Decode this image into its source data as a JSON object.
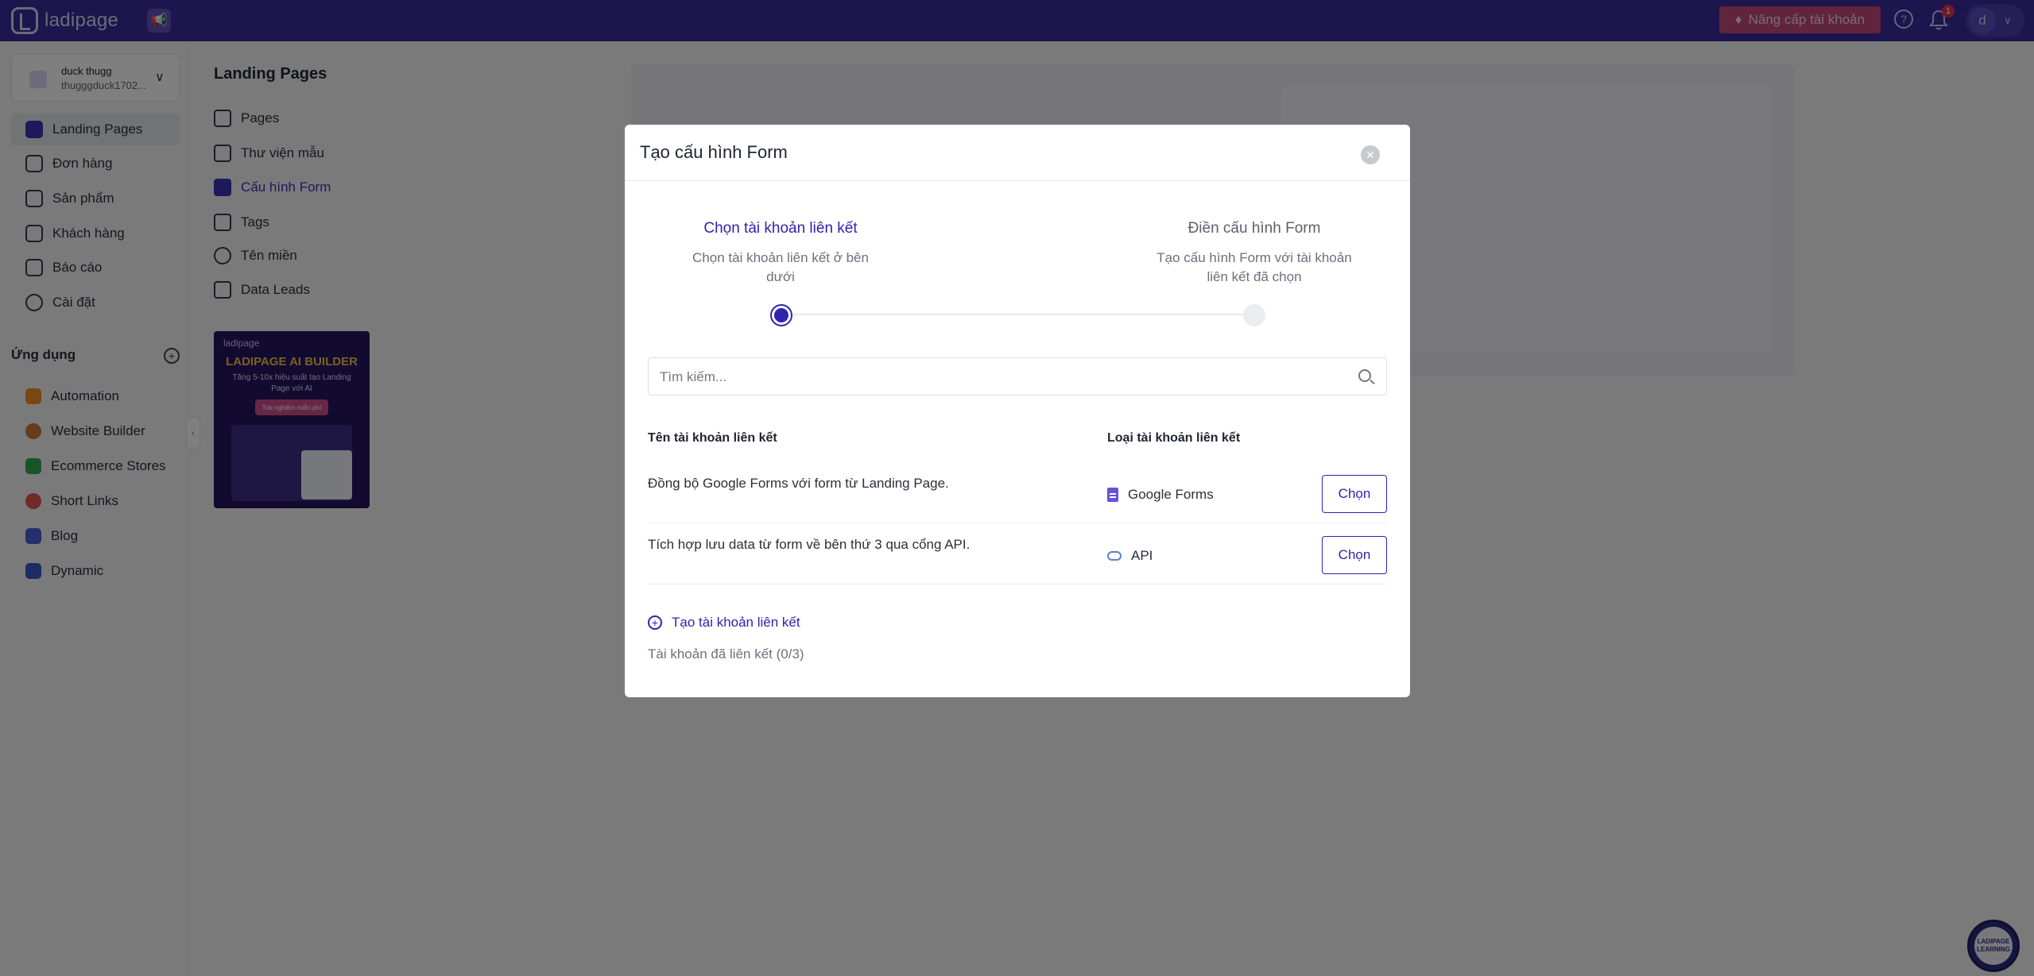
{
  "topbar": {
    "brand": "ladipage",
    "upgrade_label": "Nâng cấp tài khoản",
    "notification_count": "1",
    "avatar_initial": "d"
  },
  "account": {
    "name": "duck thugg",
    "email": "thugggduck1702..."
  },
  "leftnav": {
    "items": [
      {
        "label": "Landing Pages"
      },
      {
        "label": "Đơn hàng"
      },
      {
        "label": "Sản phẩm"
      },
      {
        "label": "Khách hàng"
      },
      {
        "label": "Báo cáo"
      },
      {
        "label": "Cài đặt"
      }
    ],
    "apps_title": "Ứng dụng",
    "apps": [
      {
        "label": "Automation",
        "color": "#f28c28"
      },
      {
        "label": "Website Builder",
        "color": "#c9783e"
      },
      {
        "label": "Ecommerce Stores",
        "color": "#2fa84f"
      },
      {
        "label": "Short Links",
        "color": "#e2554f"
      },
      {
        "label": "Blog",
        "color": "#4a5fd6"
      },
      {
        "label": "Dynamic",
        "color": "#3b5bc7"
      }
    ]
  },
  "subnav": {
    "title": "Landing Pages",
    "items": [
      {
        "label": "Pages"
      },
      {
        "label": "Thư viện mẫu"
      },
      {
        "label": "Cấu hình Form"
      },
      {
        "label": "Tags"
      },
      {
        "label": "Tên miền"
      },
      {
        "label": "Data Leads"
      }
    ],
    "banner": {
      "logo": "ladipage",
      "title": "LADIPAGE AI BUILDER",
      "subtitle": "Tăng 5-10x hiệu suất tạo Landing Page với AI",
      "button": "Trải nghiệm miễn phí"
    }
  },
  "modal": {
    "title": "Tạo cấu hình Form",
    "steps": [
      {
        "title": "Chọn tài khoản liên kết",
        "desc": "Chọn tài khoản liên kết ở bên dưới"
      },
      {
        "title": "Điền cấu hình Form",
        "desc": "Tạo cấu hình Form với tài khoản liên kết đã chọn"
      }
    ],
    "search_placeholder": "Tìm kiếm...",
    "col_name": "Tên tài khoản liên kết",
    "col_type": "Loại tài khoản liên kết",
    "rows": [
      {
        "desc": "Đồng bộ Google Forms với form từ Landing Page.",
        "type": "Google Forms",
        "button": "Chọn"
      },
      {
        "desc": "Tích hợp lưu data từ form về bên thứ 3 qua cổng API.",
        "type": "API",
        "button": "Chọn"
      }
    ],
    "create_link": "Tạo tài khoản liên kết",
    "linked_count": "Tài khoản đã liên kết (0/3)"
  },
  "learning_badge": "LADIPAGE LEARNING",
  "colors": {
    "topbar": "#3a2b9a",
    "accent": "#2f23b0",
    "upgrade": "#c04a7a"
  }
}
